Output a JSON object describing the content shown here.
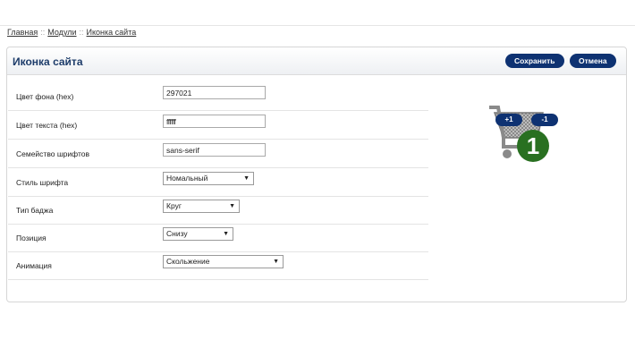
{
  "breadcrumb": {
    "items": [
      "Главная",
      "Модули",
      "Иконка сайта"
    ],
    "separator": "::"
  },
  "panel": {
    "title": "Иконка сайта",
    "save_label": "Сохранить",
    "cancel_label": "Отмена"
  },
  "form": {
    "rows": [
      {
        "label": "Цвет фона (hex)",
        "value": "297021",
        "kind": "text"
      },
      {
        "label": "Цвет текста (hex)",
        "value": "ffffff",
        "kind": "text"
      },
      {
        "label": "Семейство шрифтов",
        "value": "sans-serif",
        "kind": "text"
      },
      {
        "label": "Стиль шрифта",
        "value": "Номальный",
        "kind": "select"
      },
      {
        "label": "Тип баджа",
        "value": "Круг",
        "kind": "select"
      },
      {
        "label": "Позиция",
        "value": "Снизу",
        "kind": "select"
      },
      {
        "label": "Анимация",
        "value": "Скольжение",
        "kind": "select"
      }
    ]
  },
  "preview": {
    "badge_count": "1",
    "badge_color": "#297021",
    "plus_label": "+1",
    "minus_label": "-1",
    "icon": "cart-icon"
  },
  "colors": {
    "accent": "#0e3272",
    "title": "#1d3c6a"
  }
}
